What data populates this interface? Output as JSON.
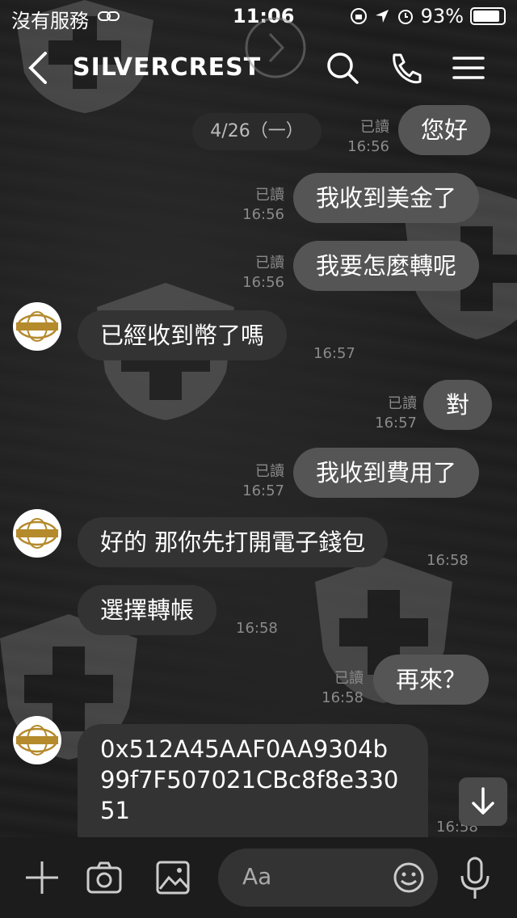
{
  "status": {
    "carrier": "沒有服務",
    "time": "11:06",
    "battery": "93%"
  },
  "header": {
    "title": "SILVERCREST"
  },
  "date_separator": "4/26（一）",
  "messages": [
    {
      "dir": "out",
      "text": "您好",
      "read": "已讀",
      "time": "16:56"
    },
    {
      "dir": "out",
      "text": "我收到美金了",
      "read": "已讀",
      "time": "16:56"
    },
    {
      "dir": "out",
      "text": "我要怎麼轉呢",
      "read": "已讀",
      "time": "16:56"
    },
    {
      "dir": "in",
      "text": "已經收到幣了嗎",
      "time": "16:57"
    },
    {
      "dir": "out",
      "text": "對",
      "read": "已讀",
      "time": "16:57"
    },
    {
      "dir": "out",
      "text": "我收到費用了",
      "read": "已讀",
      "time": "16:57"
    },
    {
      "dir": "in",
      "text": "好的 那你先打開電子錢包",
      "time": "16:58"
    },
    {
      "dir": "in",
      "text": "選擇轉帳",
      "time": "16:58"
    },
    {
      "dir": "out",
      "text": "再來？",
      "read": "已讀",
      "time": "16:58"
    },
    {
      "dir": "in",
      "text": "0x512A45AAF0AA9304b",
      "text2": "99f7F507021CBc8f8e330",
      "text3": "51",
      "time": "16:58"
    }
  ],
  "input": {
    "placeholder": "Aa"
  },
  "colors": {
    "outgoing_bubble": "#555555",
    "incoming_bubble": "#333333",
    "background": "#1a1a1a"
  }
}
